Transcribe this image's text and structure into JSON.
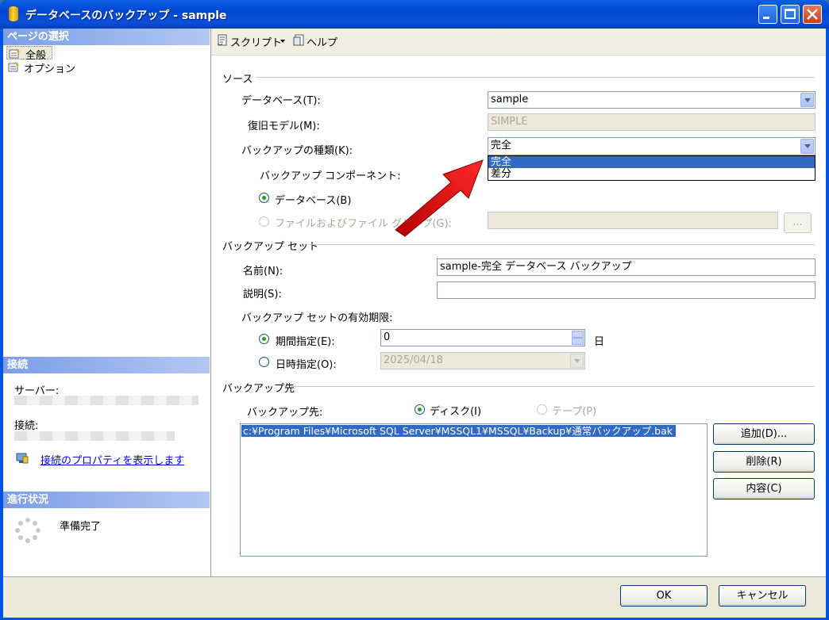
{
  "window": {
    "title": "データベースのバックアップ - sample"
  },
  "left": {
    "select_page_header": "ページの選択",
    "pages": [
      {
        "label": "全般"
      },
      {
        "label": "オプション"
      }
    ],
    "connection_header": "接続",
    "server_label": "サーバー:",
    "connection_label": "接続:",
    "view_props_link": "接続のプロパティを表示します",
    "progress_header": "進行状況",
    "progress_status": "準備完了"
  },
  "toolbar": {
    "script_label": "スクリプト",
    "help_label": "ヘルプ"
  },
  "source": {
    "header": "ソース",
    "database_label": "データベース(T):",
    "database_value": "sample",
    "recovery_label": "復旧モデル(M):",
    "recovery_value": "SIMPLE",
    "backup_type_label": "バックアップの種類(K):",
    "backup_type_value": "完全",
    "backup_type_options": [
      "完全",
      "差分"
    ],
    "component_label": "バックアップ コンポーネント:",
    "component_db": "データベース(B)",
    "component_files": "ファイルおよびファイル グループ(G):",
    "files_browse": "..."
  },
  "backup_set": {
    "header": "バックアップ セット",
    "name_label": "名前(N):",
    "name_value": "sample-完全 データベース バックアップ",
    "desc_label": "説明(S):",
    "desc_value": "",
    "expire_label": "バックアップ セットの有効期限:",
    "after_label": "期間指定(E):",
    "after_value": "0",
    "after_unit": "日",
    "on_label": "日時指定(O):",
    "on_value": "2025/04/18"
  },
  "destination": {
    "header": "バックアップ先",
    "dest_label": "バックアップ先:",
    "disk_label": "ディスク(I)",
    "tape_label": "テープ(P)",
    "paths": [
      "c:¥Program Files¥Microsoft SQL Server¥MSSQL1¥MSSQL¥Backup¥通常バックアップ.bak"
    ],
    "add_button": "追加(D)...",
    "remove_button": "削除(R)",
    "contents_button": "内容(C)"
  },
  "footer": {
    "ok": "OK",
    "cancel": "キャンセル"
  }
}
